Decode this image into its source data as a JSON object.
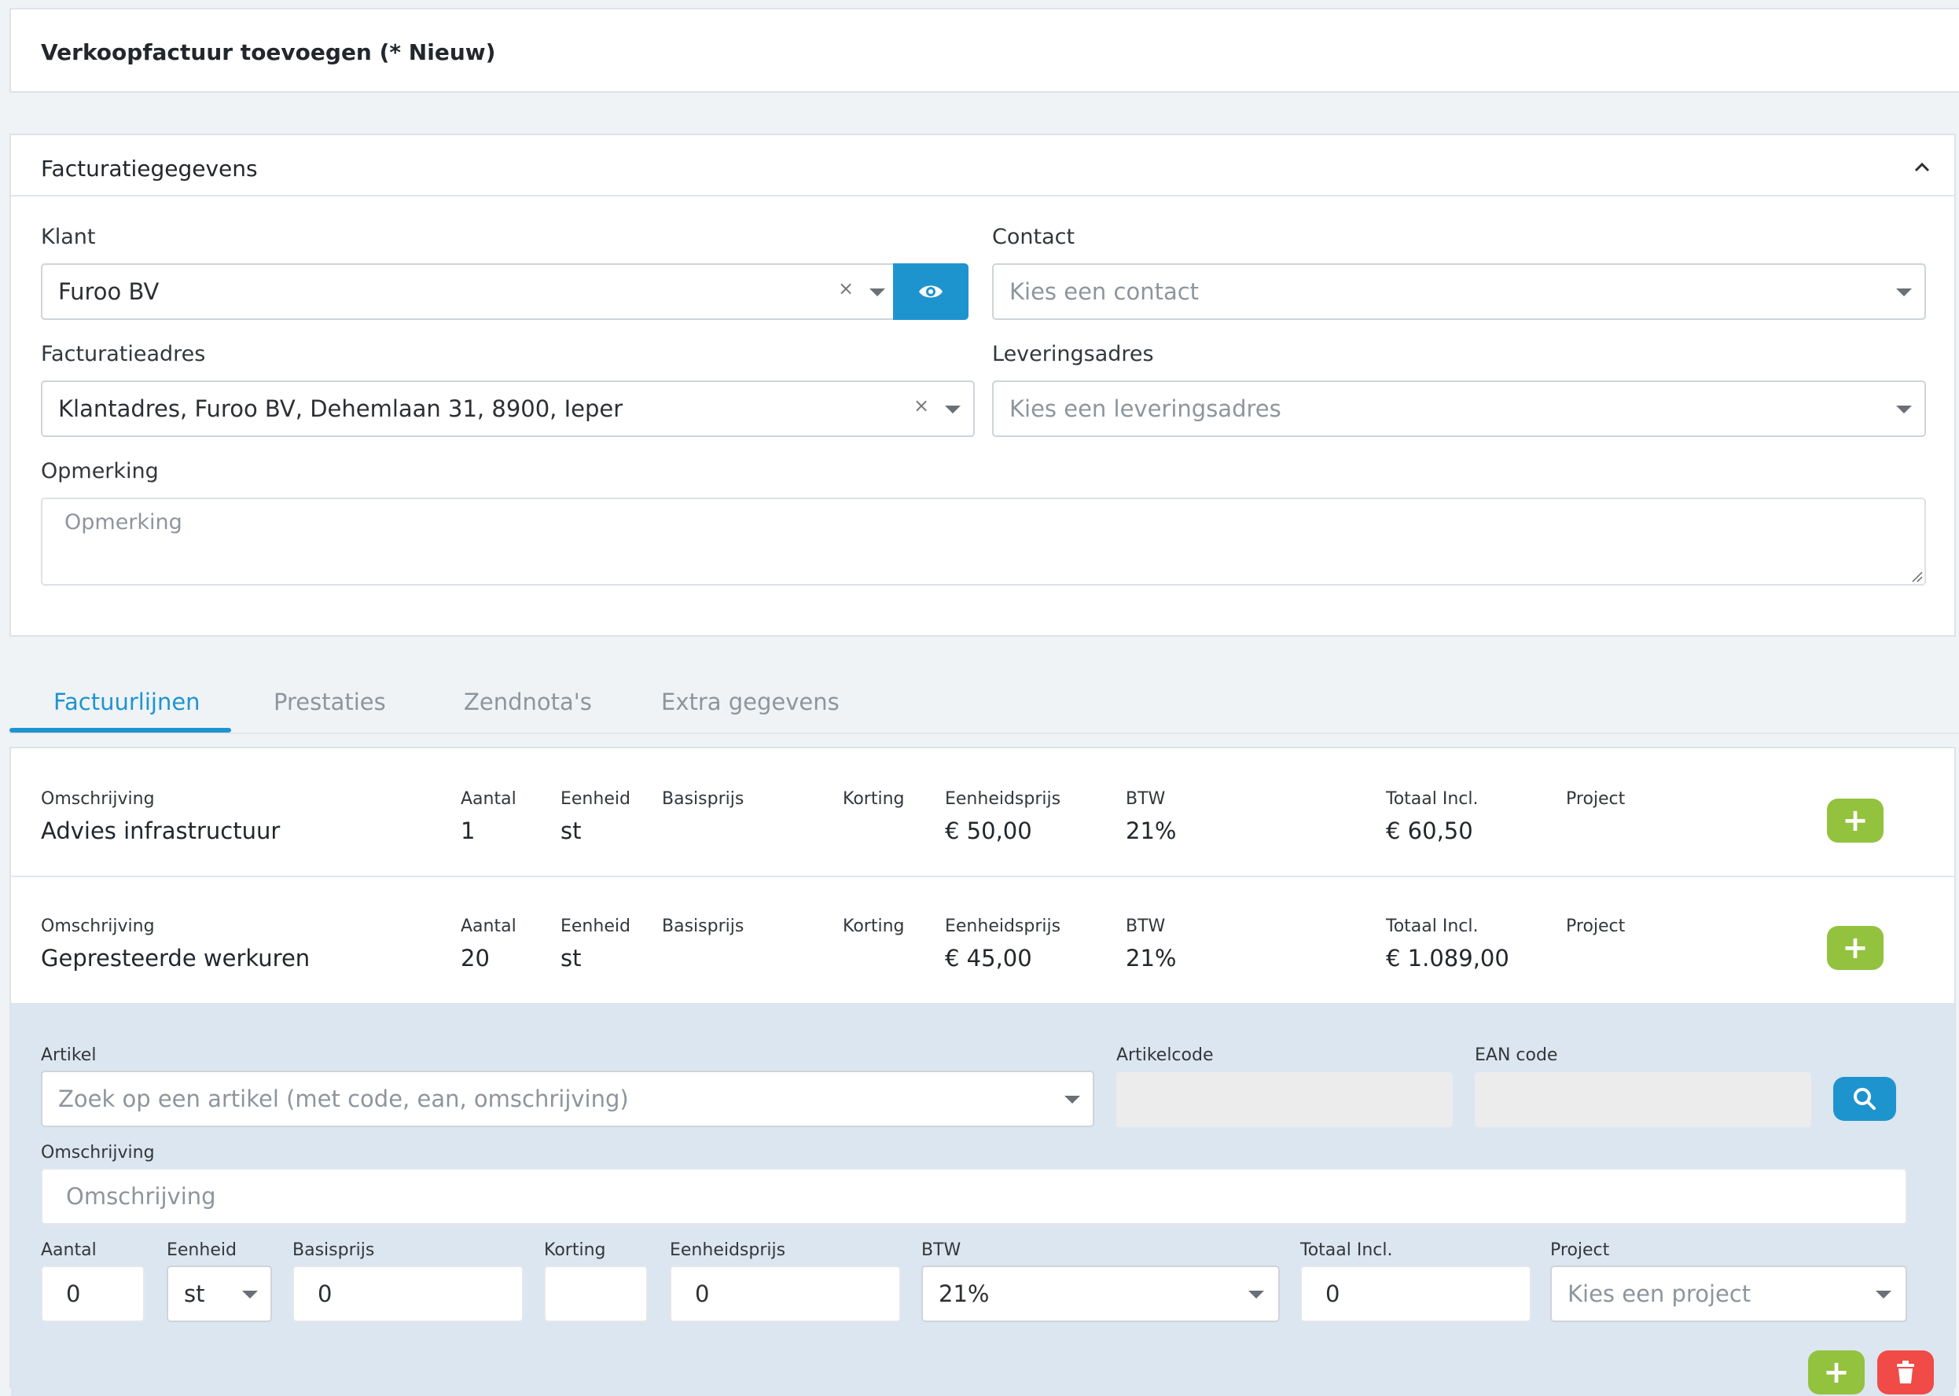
{
  "header": {
    "title": "Verkoopfactuur toevoegen (* Nieuw)"
  },
  "billing": {
    "title": "Facturatiegegevens",
    "klant_label": "Klant",
    "klant_value": "Furoo BV",
    "contact_label": "Contact",
    "contact_placeholder": "Kies een contact",
    "factadres_label": "Facturatieadres",
    "factadres_value": "Klantadres, Furoo BV, Dehemlaan 31, 8900, Ieper",
    "levadres_label": "Leveringsadres",
    "levadres_placeholder": "Kies een leveringsadres",
    "opmerking_label": "Opmerking",
    "opmerking_placeholder": "Opmerking"
  },
  "tabs": [
    "Factuurlijnen",
    "Prestaties",
    "Zendnota's",
    "Extra gegevens"
  ],
  "columns": {
    "omschrijving": "Omschrijving",
    "aantal": "Aantal",
    "eenheid": "Eenheid",
    "basisprijs": "Basisprijs",
    "korting": "Korting",
    "eenheidsprijs": "Eenheidsprijs",
    "btw": "BTW",
    "totaal": "Totaal Incl.",
    "project": "Project"
  },
  "lines": [
    {
      "omschrijving": "Advies infrastructuur",
      "aantal": "1",
      "eenheid": "st",
      "eenheidsprijs": "€ 50,00",
      "btw": "21%",
      "totaal": "€ 60,50"
    },
    {
      "omschrijving": "Gepresteerde werkuren",
      "aantal": "20",
      "eenheid": "st",
      "eenheidsprijs": "€ 45,00",
      "btw": "21%",
      "totaal": "€ 1.089,00"
    }
  ],
  "new_line": {
    "artikel_label": "Artikel",
    "artikel_placeholder": "Zoek op een artikel (met code, ean, omschrijving)",
    "artikelcode_label": "Artikelcode",
    "ean_label": "EAN code",
    "omschrijving_label": "Omschrijving",
    "omschrijving_placeholder": "Omschrijving",
    "aantal_label": "Aantal",
    "aantal_value": "0",
    "eenheid_label": "Eenheid",
    "eenheid_value": "st",
    "basisprijs_label": "Basisprijs",
    "basisprijs_value": "0",
    "korting_label": "Korting",
    "eenheidsprijs_label": "Eenheidsprijs",
    "eenheidsprijs_value": "0",
    "btw_label": "BTW",
    "btw_value": "21%",
    "totaal_label": "Totaal Incl.",
    "totaal_value": "0",
    "project_label": "Project",
    "project_placeholder": "Kies een project"
  },
  "colors": {
    "accent": "#1e94cf",
    "green": "#93c23f",
    "red": "#f04b46"
  }
}
